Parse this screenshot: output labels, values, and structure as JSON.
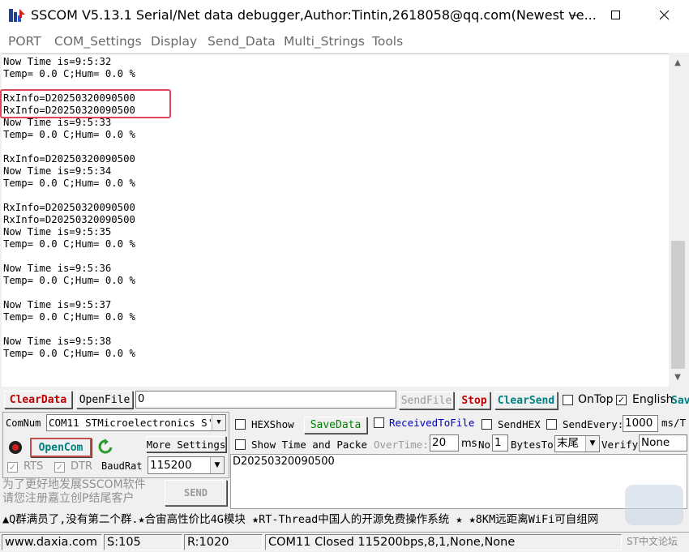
{
  "window": {
    "title": "SSCOM V5.13.1 Serial/Net data debugger,Author:Tintin,2618058@qq.com(Newest ve..."
  },
  "menu": [
    "PORT",
    "COM_Settings",
    "Display",
    "Send_Data",
    "Multi_Strings",
    "Tools"
  ],
  "receive": {
    "lines": [
      "Now Time is=9:5:32",
      "Temp= 0.0 C;Hum= 0.0 %",
      "",
      "RxInfo=D20250320090500",
      "RxInfo=D20250320090500",
      "Now Time is=9:5:33",
      "Temp= 0.0 C;Hum= 0.0 %",
      "",
      "RxInfo=D20250320090500",
      "Now Time is=9:5:34",
      "Temp= 0.0 C;Hum= 0.0 %",
      "",
      "RxInfo=D20250320090500",
      "RxInfo=D20250320090500",
      "Now Time is=9:5:35",
      "Temp= 0.0 C;Hum= 0.0 %",
      "",
      "Now Time is=9:5:36",
      "Temp= 0.0 C;Hum= 0.0 %",
      "",
      "Now Time is=9:5:37",
      "Temp= 0.0 C;Hum= 0.0 %",
      "",
      "Now Time is=9:5:38",
      "Temp= 0.0 C;Hum= 0.0 %"
    ]
  },
  "toolbar1": {
    "clear_data": "ClearData",
    "open_file": "OpenFile",
    "file_path": "0",
    "send_file": "SendFile",
    "stop": "Stop",
    "clear_send": "ClearSend",
    "on_top": "OnTop",
    "english": "English",
    "save_cut": "Sav"
  },
  "port": {
    "comnum_label": "ComNum",
    "comnum_value": "COM11 STMicroelectronics S'",
    "open_com": "OpenCom",
    "more_settings": "More Settings",
    "rts": "RTS",
    "dtr": "DTR",
    "baud_label": "BaudRat",
    "baud_value": "115200"
  },
  "display_opts": {
    "hex_show": "HEXShow",
    "save_data": "SaveData",
    "received_to_file": "ReceivedToFile",
    "send_hex": "SendHEX",
    "send_every": "SendEvery:",
    "send_every_value": "1000",
    "ms_unit": "ms/T",
    "show_time": "Show Time and Packe",
    "overtime_label": "OverTime:",
    "overtime_value": "20",
    "ms": "ms",
    "no_label": "No",
    "no_value": "1",
    "bytes_to": "BytesTo",
    "tail_value": "末尾",
    "verify_label": "Verify",
    "verify_value": "None"
  },
  "send": {
    "text": "D20250320090500",
    "send_button": "SEND",
    "promo": [
      "为了更好地发展SSCOM软件",
      "请您注册嘉立创P结尾客户"
    ]
  },
  "ticker": "▲Q群满员了,没有第二个群.★合宙高性价比4G模块 ★RT-Thread中国人的开源免费操作系统 ★ ★8KM远距离WiFi可自组网",
  "status": {
    "website": "www.daxia.com",
    "s_count": "S:105",
    "r_count": "R:1020",
    "port_status": "COM11 Closed  115200bps,8,1,None,None",
    "watermark": "ST中文论坛"
  },
  "colors": {
    "highlight_box": "#e0455a",
    "clear_data": "#c00000",
    "clear_send": "#008080",
    "received_to_file": "#0000c0"
  }
}
